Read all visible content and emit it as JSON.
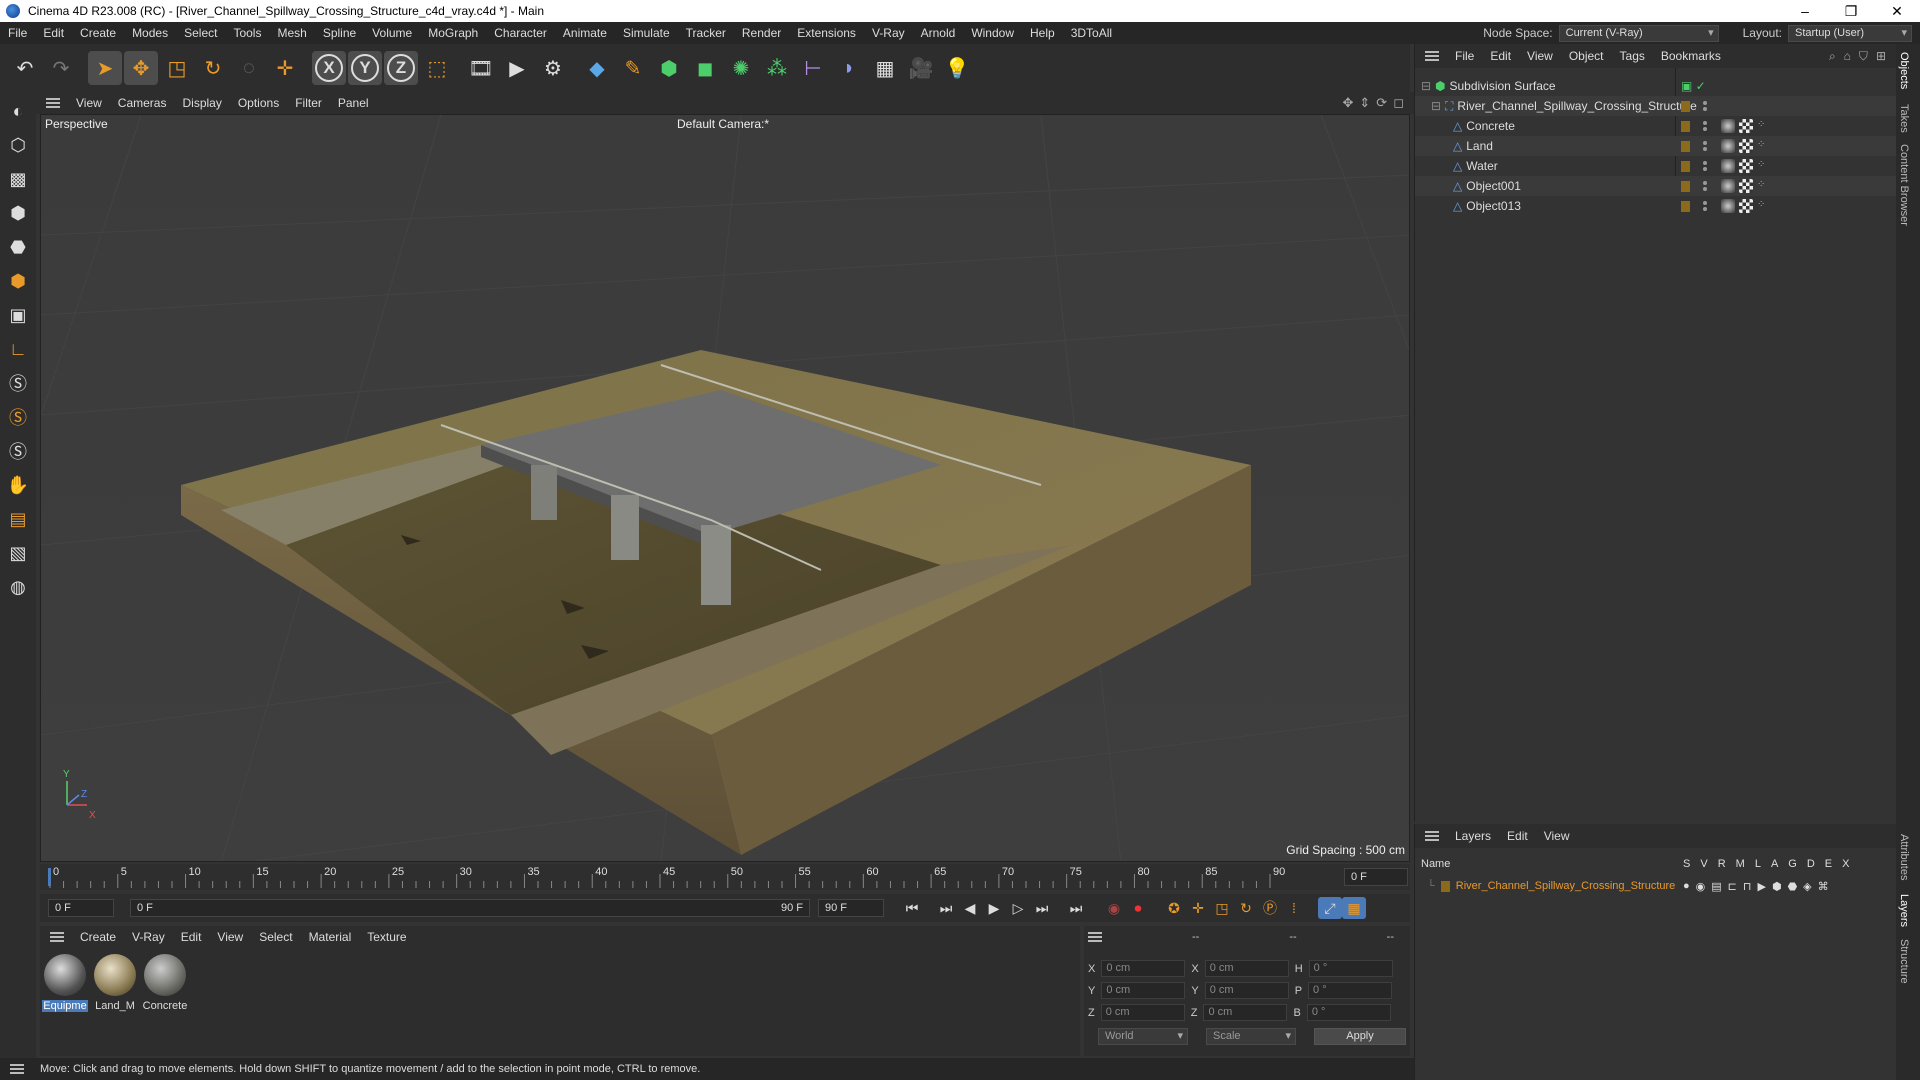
{
  "window": {
    "title": "Cinema 4D R23.008 (RC) - [River_Channel_Spillway_Crossing_Structure_c4d_vray.c4d *] - Main",
    "controls": [
      "–",
      "❐",
      "✕"
    ]
  },
  "menubar": {
    "items": [
      "File",
      "Edit",
      "Create",
      "Modes",
      "Select",
      "Tools",
      "Mesh",
      "Spline",
      "Volume",
      "MoGraph",
      "Character",
      "Animate",
      "Simulate",
      "Tracker",
      "Render",
      "Extensions",
      "V-Ray",
      "Arnold",
      "Window",
      "Help",
      "3DToAll"
    ],
    "node_space_label": "Node Space:",
    "node_space_value": "Current (V-Ray)",
    "layout_label": "Layout:",
    "layout_value": "Startup (User)"
  },
  "viewport": {
    "menu": [
      "View",
      "Cameras",
      "Display",
      "Options",
      "Filter",
      "Panel"
    ],
    "view_name": "Perspective",
    "camera": "Default Camera",
    "camera_suffix": ":*",
    "grid_spacing": "Grid Spacing : 500 cm"
  },
  "timeline": {
    "ticks": [
      "0",
      "5",
      "10",
      "15",
      "20",
      "25",
      "30",
      "35",
      "40",
      "45",
      "50",
      "55",
      "60",
      "65",
      "70",
      "75",
      "80",
      "85",
      "90"
    ],
    "end_field": "0 F"
  },
  "playbar": {
    "start": "0 F",
    "range_start": "0 F",
    "range_end": "90 F",
    "end": "90 F"
  },
  "material_manager": {
    "menu": [
      "Create",
      "V-Ray",
      "Edit",
      "View",
      "Select",
      "Material",
      "Texture"
    ],
    "materials": [
      {
        "name": "Equipme"
      },
      {
        "name": "Land_M"
      },
      {
        "name": "Concrete"
      }
    ]
  },
  "coords": {
    "headers": [
      "--",
      "--",
      "--"
    ],
    "rows": [
      {
        "a": "X",
        "av": "0 cm",
        "b": "X",
        "bv": "0 cm",
        "c": "H",
        "cv": "0 °"
      },
      {
        "a": "Y",
        "av": "0 cm",
        "b": "Y",
        "bv": "0 cm",
        "c": "P",
        "cv": "0 °"
      },
      {
        "a": "Z",
        "av": "0 cm",
        "b": "Z",
        "bv": "0 cm",
        "c": "B",
        "cv": "0 °"
      }
    ],
    "mode1": "World",
    "mode2": "Scale",
    "apply": "Apply"
  },
  "status": "Move: Click and drag to move elements. Hold down SHIFT to quantize movement / add to the selection in point mode, CTRL to remove.",
  "object_manager": {
    "menu": [
      "File",
      "Edit",
      "View",
      "Object",
      "Tags",
      "Bookmarks"
    ],
    "objects": [
      {
        "name": "Subdivision Surface"
      },
      {
        "name": "River_Channel_Spillway_Crossing_Structure"
      },
      {
        "name": "Concrete"
      },
      {
        "name": "Land"
      },
      {
        "name": "Water"
      },
      {
        "name": "Object001"
      },
      {
        "name": "Object013"
      }
    ]
  },
  "layer_manager": {
    "menu": [
      "Layers",
      "Edit",
      "View"
    ],
    "col_name": "Name",
    "cols": [
      "S",
      "V",
      "R",
      "M",
      "L",
      "A",
      "G",
      "D",
      "E",
      "X"
    ],
    "layer": "River_Channel_Spillway_Crossing_Structure"
  },
  "side_tabs": [
    "Objects",
    "Takes",
    "Content Browser",
    "Attributes",
    "Layers",
    "Structure"
  ],
  "colors": {
    "accent_orange": "#e89a2b",
    "layer_swatch": "#8c6a1c",
    "selection_blue": "#4a7ab8"
  }
}
